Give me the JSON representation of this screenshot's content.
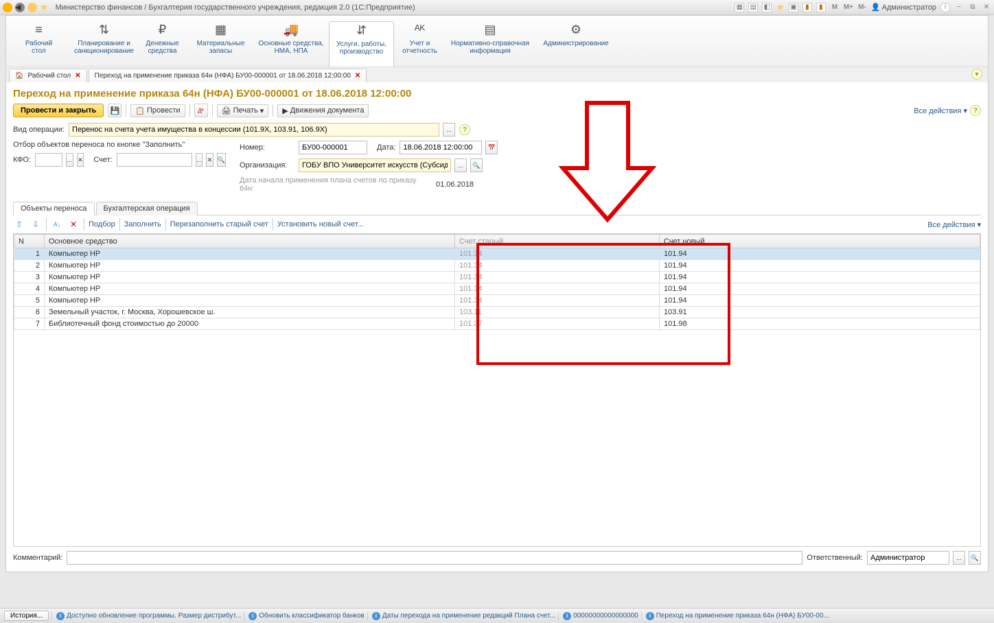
{
  "titlebar": {
    "title": "Министерство финансов / Бухгалтерия государственного учреждения, редакция 2.0  (1С:Предприятие)",
    "user": "Администратор",
    "m": "M",
    "mplus": "M+",
    "mminus": "M-"
  },
  "nav": [
    {
      "icon": "≡",
      "label": "Рабочий\nстол"
    },
    {
      "icon": "⇅",
      "label": "Планирование и\nсанкционирование"
    },
    {
      "icon": "₽",
      "label": "Денежные\nсредства"
    },
    {
      "icon": "▦",
      "label": "Материальные\nзапасы"
    },
    {
      "icon": "🚚",
      "label": "Основные средства,\nНМА, НПА"
    },
    {
      "icon": "⇵",
      "label": "Услуги, работы,\nпроизводство"
    },
    {
      "icon": "ᴬᴷ",
      "label": "Учет и\nотчетность"
    },
    {
      "icon": "▤",
      "label": "Нормативно-справочная\nинформация"
    },
    {
      "icon": "⚙",
      "label": "Администрирование"
    }
  ],
  "tabs": {
    "tab1": "Рабочий стол",
    "tab2": "Переход на применение приказа 64н (НФА) БУ00-000001 от 18.06.2018 12:00:00"
  },
  "doc": {
    "title": "Переход на применение приказа 64н (НФА) БУ00-000001 от 18.06.2018 12:00:00",
    "btn_primary": "Провести и закрыть",
    "btn_provesti": "Провести",
    "btn_pechat": "Печать",
    "btn_dvizh": "Движения документа",
    "all_actions": "Все действия",
    "vid_op_label": "Вид операции:",
    "vid_op_value": "Перенос на счета учета имущества в концессии (101.9Х, 103.91, 106.9Х)",
    "otbor_label": "Отбор объектов переноса по кнопке \"Заполнить\"",
    "kfo_label": "КФО:",
    "schet_label": "Счет:",
    "nomer_label": "Номер:",
    "nomer_value": "БУ00-000001",
    "data_label": "Дата:",
    "data_value": "18.06.2018 12:00:00",
    "org_label": "Организация:",
    "org_value": "ГОБУ ВПО Университет искусств (Субсидия)",
    "plan_label": "Дата начала применения плана счетов по приказу 64н:",
    "plan_value": "01.06.2018"
  },
  "inner_tabs": {
    "t1": "Объекты переноса",
    "t2": "Бухгалтерская операция"
  },
  "table_toolbar": {
    "podbor": "Подбор",
    "zapolnit": "Заполнить",
    "perezap": "Перезаполнить старый счет",
    "ustanov": "Установить новый счет...",
    "all_actions": "Все действия"
  },
  "table": {
    "headers": {
      "n": "N",
      "name": "Основное средство",
      "old": "Счет старый",
      "new": "Счет новый"
    },
    "rows": [
      {
        "n": "1",
        "name": "Компьютер HP",
        "old": "101.34",
        "new": "101.94"
      },
      {
        "n": "2",
        "name": "Компьютер HP",
        "old": "101.34",
        "new": "101.94"
      },
      {
        "n": "3",
        "name": "Компьютер HP",
        "old": "101.34",
        "new": "101.94"
      },
      {
        "n": "4",
        "name": "Компьютер HP",
        "old": "101.34",
        "new": "101.94"
      },
      {
        "n": "5",
        "name": "Компьютер HP",
        "old": "101.34",
        "new": "101.94"
      },
      {
        "n": "6",
        "name": "Земельный участок, г. Москва, Хорошевское ш.",
        "old": "103.11",
        "new": "103.91"
      },
      {
        "n": "7",
        "name": "Библиотечный фонд стоимостью до 20000",
        "old": "101.37",
        "new": "101.98"
      }
    ]
  },
  "footer": {
    "komment": "Комментарий:",
    "otvet": "Ответственный:",
    "otvet_value": "Администратор"
  },
  "statusbar": {
    "history": "История...",
    "s1": "Доступно обновление программы. Размер дистрибут...",
    "s2": "Обновить классификатор банков",
    "s3": "Даты перехода на применение редакций Плана счет...",
    "s4": "00000000000000000",
    "s5": "Переход на применение приказа 64н (НФА) БУ00-00..."
  }
}
